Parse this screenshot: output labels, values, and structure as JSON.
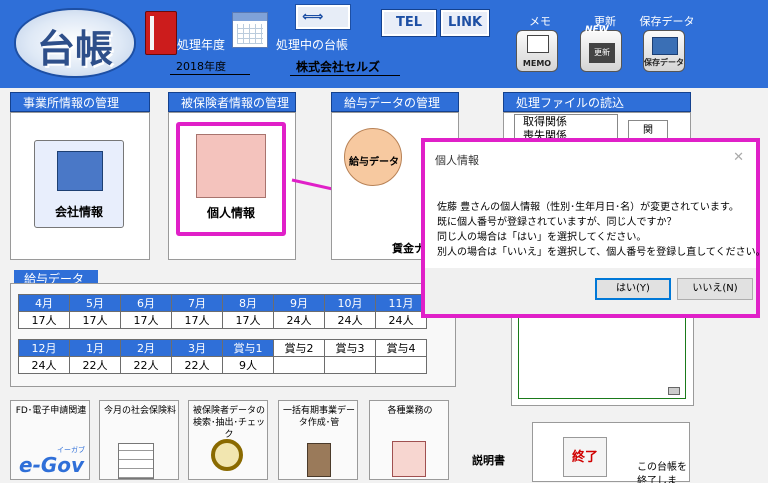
{
  "header": {
    "logo_text": "台帳",
    "fiscal_year_label": "処理年度",
    "fiscal_year_value": "2018年度",
    "current_ledger_label": "処理中の台帳",
    "current_ledger_value": "株式会社セルズ",
    "tel_button": "TEL",
    "link_button": "LINK",
    "tools": [
      {
        "label": "メモ",
        "icon_text": "MEMO",
        "icon": "memo-icon"
      },
      {
        "label": "更新",
        "icon_text": "更新",
        "badge": "NEW",
        "icon": "update-icon"
      },
      {
        "label": "保存データ",
        "icon_text": "保存データ",
        "icon": "save-data-icon"
      }
    ]
  },
  "sections": {
    "office": {
      "title": "事業所情報の管理",
      "button": "会社情報"
    },
    "insured": {
      "title": "被保険者情報の管理",
      "button": "個人情報"
    },
    "payroll": {
      "title": "給与データの管理",
      "button": "給与データ",
      "button2_partial": "賃金ナ"
    },
    "files": {
      "title": "処理ファイルの読込",
      "list": [
        "取得関係",
        "喪失関係"
      ],
      "button_partial": "関"
    }
  },
  "salary": {
    "title": "給与データ",
    "row1_months": [
      "4月",
      "5月",
      "6月",
      "7月",
      "8月",
      "9月",
      "10月",
      "11月"
    ],
    "row1_counts": [
      "17人",
      "17人",
      "17人",
      "17人",
      "17人",
      "24人",
      "24人",
      "24人"
    ],
    "row2_months": [
      "12月",
      "1月",
      "2月",
      "3月",
      "賞与1",
      "賞与2",
      "賞与3",
      "賞与4"
    ],
    "row2_counts": [
      "24人",
      "22人",
      "22人",
      "22人",
      "9人",
      "",
      "",
      ""
    ]
  },
  "utilities": [
    {
      "label": "FD･電子申請関連",
      "brand": "e-Gov",
      "brand_sub": "イーガブ"
    },
    {
      "label": "今月の社会保険料"
    },
    {
      "label": "被保険者データの検索･抽出･チェック"
    },
    {
      "label": "一括有期事業データ作成･管"
    },
    {
      "label": "各種業務の"
    }
  ],
  "manual_label": "説明書",
  "exit": {
    "button": "終了",
    "text": "この台帳を終了しま"
  },
  "dialog": {
    "title": "個人情報",
    "close": "✕",
    "lines": [
      "佐藤 豊さんの個人情報（性別･生年月日･名）が変更されています。",
      "既に個人番号が登録されていますが、同じ人ですか？",
      "同じ人の場合は「はい」を選択してください。",
      "別人の場合は「いいえ」を選択して、個人番号を登録し直してください。"
    ],
    "yes_button": "はい(Y)",
    "no_button": "いいえ(N)"
  },
  "colors": {
    "accent": "#2f6fd8",
    "highlight": "#e020c8"
  }
}
